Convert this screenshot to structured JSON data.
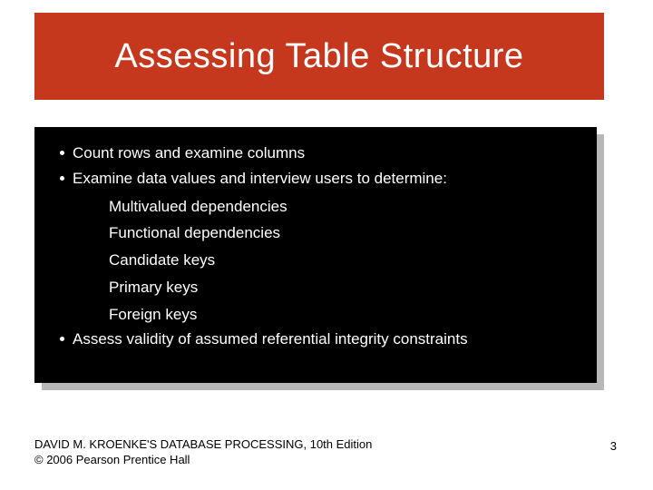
{
  "title": "Assessing Table Structure",
  "bullets": {
    "b1a": "Count rows and examine columns",
    "b1b": "Examine data values and interview users to determine:",
    "s1": "Multivalued dependencies",
    "s2": "Functional dependencies",
    "s3": "Candidate keys",
    "s4": "Primary keys",
    "s5": "Foreign keys",
    "b1c": "Assess validity of assumed referential integrity constraints"
  },
  "footer": {
    "line1": "DAVID M. KROENKE'S DATABASE PROCESSING, 10th Edition",
    "line2": "© 2006 Pearson Prentice Hall"
  },
  "page_number": "3"
}
